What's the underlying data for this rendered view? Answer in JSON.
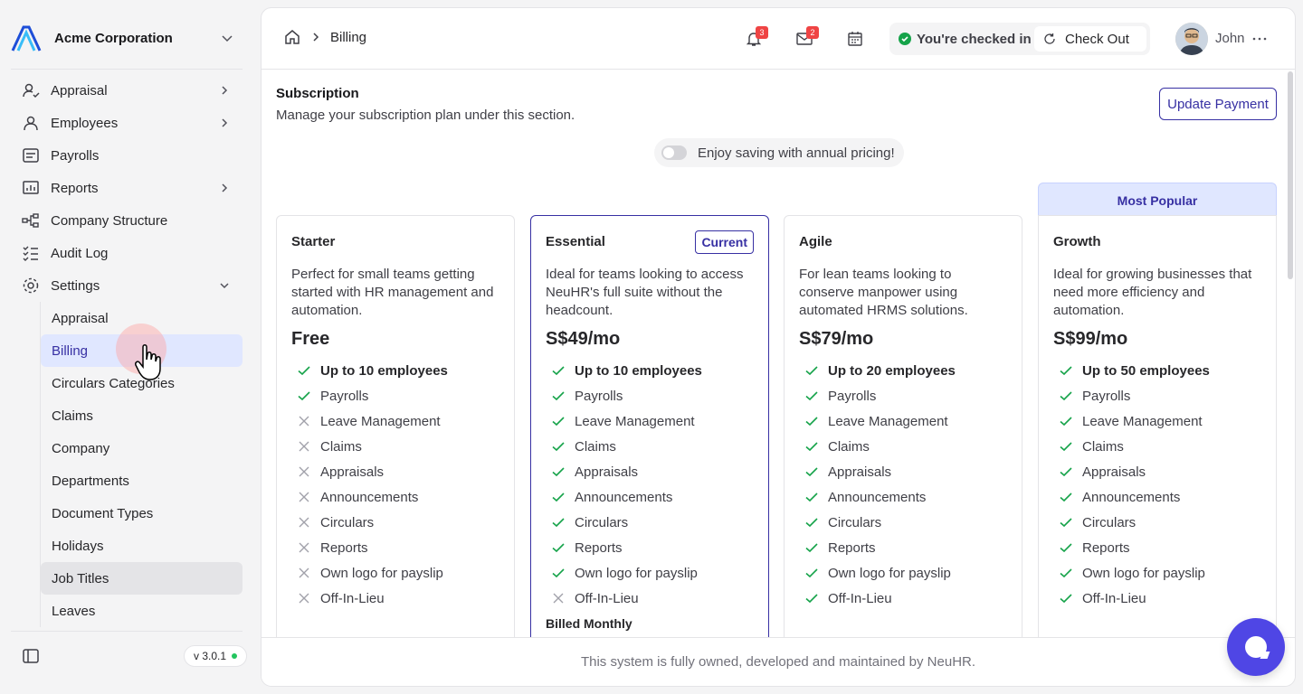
{
  "org": {
    "name": "Acme Corporation"
  },
  "sidebar": {
    "items": [
      {
        "label": "Appraisal",
        "icon": "user-check-icon",
        "expandable": true
      },
      {
        "label": "Employees",
        "icon": "user-icon",
        "expandable": true
      },
      {
        "label": "Payrolls",
        "icon": "receipt-icon",
        "expandable": false
      },
      {
        "label": "Reports",
        "icon": "chart-icon",
        "expandable": true
      },
      {
        "label": "Company Structure",
        "icon": "org-structure-icon",
        "expandable": false
      },
      {
        "label": "Audit Log",
        "icon": "list-check-icon",
        "expandable": false
      },
      {
        "label": "Settings",
        "icon": "gear-icon",
        "expandable": true,
        "expanded": true
      }
    ],
    "settings_items": [
      {
        "label": "Appraisal"
      },
      {
        "label": "Billing",
        "active": true
      },
      {
        "label": "Circulars Categories"
      },
      {
        "label": "Claims"
      },
      {
        "label": "Company"
      },
      {
        "label": "Departments"
      },
      {
        "label": "Document Types"
      },
      {
        "label": "Holidays"
      },
      {
        "label": "Job Titles",
        "hover": true
      },
      {
        "label": "Leaves"
      }
    ],
    "version": "v 3.0.1"
  },
  "header": {
    "breadcrumb": "Billing",
    "notifications_count": "3",
    "inbox_count": "2",
    "checkin_text": "You're checked in",
    "checkout_label": "Check Out",
    "user_name": "John"
  },
  "subscription": {
    "title": "Subscription",
    "description": "Manage your subscription plan under this section.",
    "update_payment_label": "Update Payment",
    "annual_toggle_label": "Enjoy saving with annual pricing!",
    "annual_enabled": false,
    "most_popular_label": "Most Popular",
    "current_label": "Current",
    "billed_label": "Billed Monthly"
  },
  "features": [
    "Payrolls",
    "Leave Management",
    "Claims",
    "Appraisals",
    "Announcements",
    "Circulars",
    "Reports",
    "Own logo for payslip",
    "Off-In-Lieu"
  ],
  "plans": [
    {
      "name": "Starter",
      "description": "Perfect for small teams getting started with HR management and automation.",
      "price": "Free",
      "headline": "Up to 10 employees",
      "included": [
        true,
        false,
        false,
        false,
        false,
        false,
        false,
        false,
        false
      ],
      "current": false
    },
    {
      "name": "Essential",
      "description": "Ideal for teams looking to access NeuHR's full suite without the headcount.",
      "price": "S$49/mo",
      "headline": "Up to 10 employees",
      "included": [
        true,
        true,
        true,
        true,
        true,
        true,
        true,
        true,
        false
      ],
      "current": true
    },
    {
      "name": "Agile",
      "description": "For lean teams looking to conserve manpower using automated HRMS solutions.",
      "price": "S$79/mo",
      "headline": "Up to 20 employees",
      "included": [
        true,
        true,
        true,
        true,
        true,
        true,
        true,
        true,
        true
      ],
      "current": false
    },
    {
      "name": "Growth",
      "description": "Ideal for growing businesses that need more efficiency and automation.",
      "price": "S$99/mo",
      "headline": "Up to 50 employees",
      "included": [
        true,
        true,
        true,
        true,
        true,
        true,
        true,
        true,
        true
      ],
      "current": false
    }
  ],
  "footer": {
    "text": "This system is fully owned, developed and maintained by NeuHR."
  },
  "colors": {
    "accent": "#3730a3",
    "check": "#16a34a",
    "cross": "#a1a1aa",
    "chat": "#4f46e5"
  }
}
